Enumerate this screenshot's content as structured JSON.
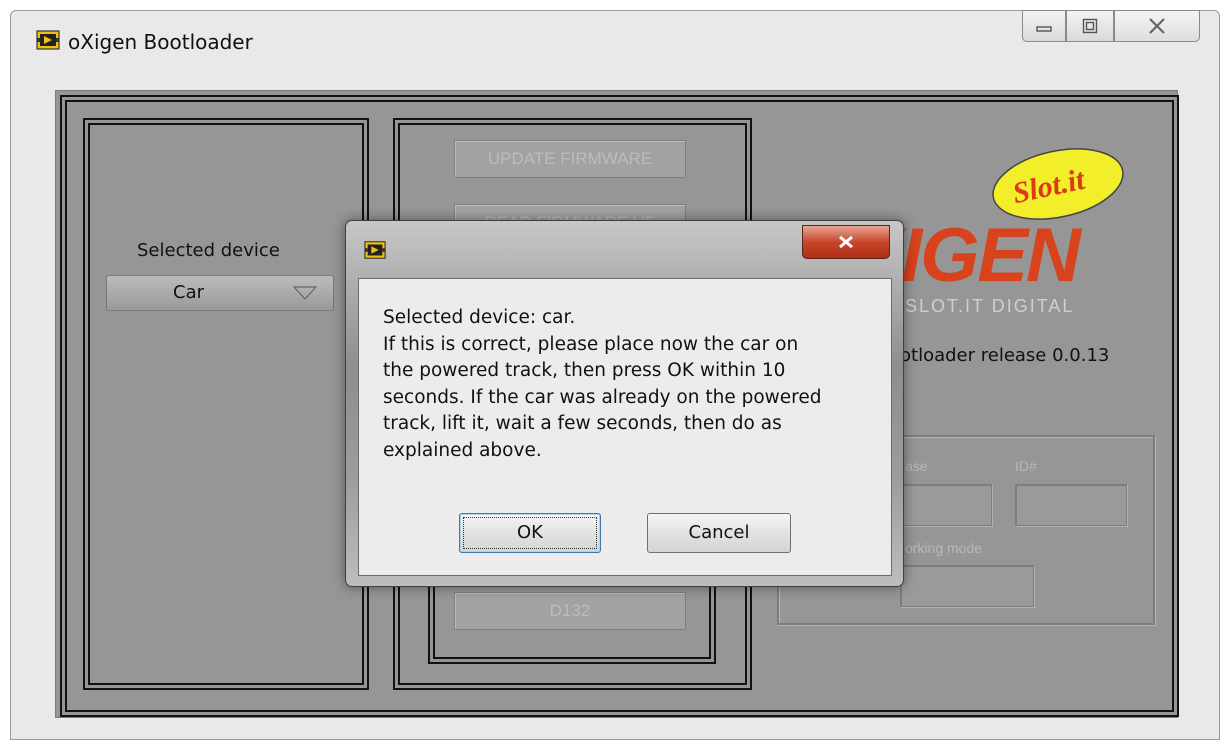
{
  "window": {
    "title": "oXigen Bootloader",
    "icon": "labview-vi-icon",
    "controls": [
      "minimize-icon",
      "maximize-icon",
      "close-icon"
    ]
  },
  "left_panel": {
    "selected_device_label": "Selected device",
    "selected_device_value": "Car"
  },
  "center_panel": {
    "update_firmware_label": "UPDATE FIRMWARE",
    "read_firmware_label": "READ FIRMWARE VE",
    "device_code_label": "D132"
  },
  "right_panel": {
    "logo_text": "oXIGEN",
    "logo_subtitle": "SLOT.IT DIGITAL",
    "brand_badge": "Slot.it",
    "release_text": "Bootloader release 0.0.13",
    "release_visible_text": "otloader release 0.0.13",
    "fields": {
      "release_label": "ase",
      "id_label": "ID#",
      "working_mode_label": "orking mode"
    }
  },
  "dialog": {
    "icon": "labview-vi-icon",
    "message": "Selected device: car.\nIf this is correct, please place now the car on\nthe powered track, then press OK within 10\nseconds. If the car was already on the powered\ntrack, lift it, wait a few seconds, then  do as\nexplained above.",
    "ok_label": "OK",
    "cancel_label": "Cancel",
    "close_icon": "close-icon"
  },
  "colors": {
    "panel_bg": "#969696",
    "logo_red": "#d8421c",
    "badge_yellow": "#f2ee2a",
    "dialog_close_red": "#c7472c"
  }
}
